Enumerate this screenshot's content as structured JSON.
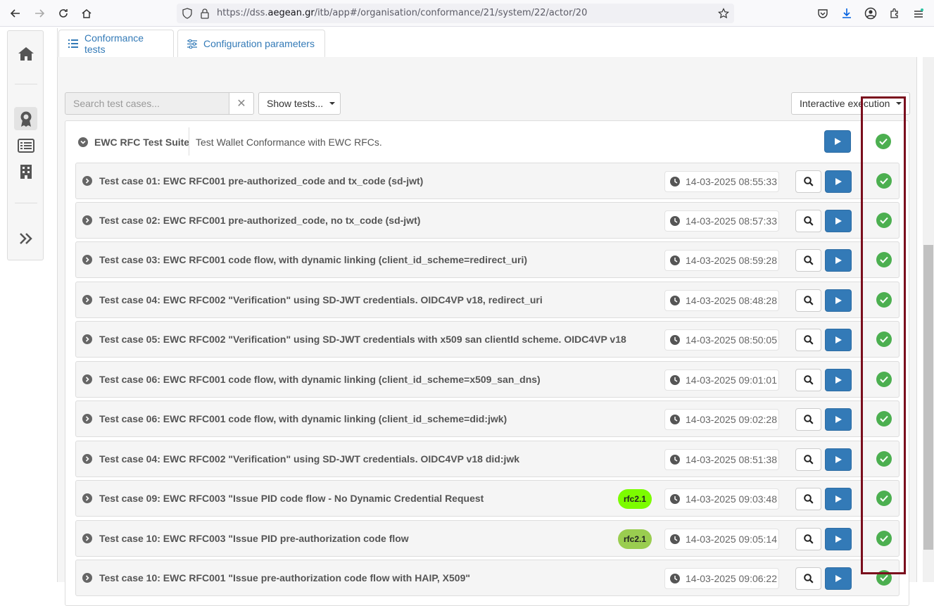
{
  "browser": {
    "url_prefix": "https://dss.",
    "url_domain": "aegean.gr",
    "url_path": "/itb/app#/organisation/conformance/21/system/22/actor/20"
  },
  "tabs": [
    {
      "label": "Conformance tests",
      "icon": "list-icon"
    },
    {
      "label": "Configuration parameters",
      "icon": "sliders-icon"
    }
  ],
  "toolbar": {
    "search_placeholder": "Search test cases...",
    "clear_symbol": "✕",
    "show_tests_label": "Show tests...",
    "execution_label": "Interactive execution"
  },
  "suite": {
    "title": "EWC RFC Test Suite",
    "description": "Test Wallet Conformance with EWC RFCs.",
    "status": "success"
  },
  "test_cases": [
    {
      "name": "Test case 01: EWC RFC001 pre-authorized_code and tx_code (sd-jwt)",
      "timestamp": "14-03-2025 08:55:33",
      "badge": "",
      "status": "success"
    },
    {
      "name": "Test case 02: EWC RFC001 pre-authorized_code, no tx_code (sd-jwt)",
      "timestamp": "14-03-2025 08:57:33",
      "badge": "",
      "status": "success"
    },
    {
      "name": "Test case 03: EWC RFC001 code flow, with dynamic linking (client_id_scheme=redirect_uri)",
      "timestamp": "14-03-2025 08:59:28",
      "badge": "",
      "status": "success"
    },
    {
      "name": "Test case 04: EWC RFC002 \"Verification\" using SD-JWT credentials. OIDC4VP v18, redirect_uri",
      "timestamp": "14-03-2025 08:48:28",
      "badge": "",
      "status": "success"
    },
    {
      "name": "Test case 05: EWC RFC002 \"Verification\" using SD-JWT credentials with x509 san clientId scheme. OIDC4VP v18",
      "timestamp": "14-03-2025 08:50:05",
      "badge": "",
      "status": "success"
    },
    {
      "name": "Test case 06: EWC RFC001 code flow, with dynamic linking (client_id_scheme=x509_san_dns)",
      "timestamp": "14-03-2025 09:01:01",
      "badge": "",
      "status": "success"
    },
    {
      "name": "Test case 06: EWC RFC001 code flow, with dynamic linking (client_id_scheme=did:jwk)",
      "timestamp": "14-03-2025 09:02:28",
      "badge": "",
      "status": "success"
    },
    {
      "name": "Test case 04: EWC RFC002 \"Verification\" using SD-JWT credentials. OIDC4VP v18 did:jwk",
      "timestamp": "14-03-2025 08:51:38",
      "badge": "",
      "status": "success"
    },
    {
      "name": "Test case 09: EWC RFC003 \"Issue PID code flow - No Dynamic Credential Request",
      "timestamp": "14-03-2025 09:03:48",
      "badge": "rfc2.1",
      "badge_color": "#7CFC00",
      "status": "success"
    },
    {
      "name": "Test case 10: EWC RFC003 \"Issue PID pre-authorization code flow",
      "timestamp": "14-03-2025 09:05:14",
      "badge": "rfc2.1",
      "badge_color": "#9ACD50",
      "status": "success"
    },
    {
      "name": "Test case 10: EWC RFC001 \"Issue pre-authorization code flow with HAIP, X509\"",
      "timestamp": "14-03-2025 09:06:22",
      "badge": "",
      "status": "success"
    }
  ],
  "colors": {
    "primary": "#337ab7",
    "success": "#4caf50",
    "highlight": "#7a0e1d"
  }
}
